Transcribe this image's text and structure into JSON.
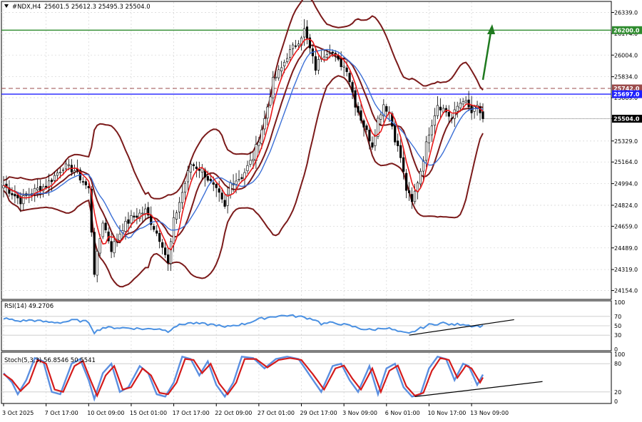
{
  "header": {
    "symbol": "#NDX,H4",
    "ohlc": "25601.5 25612.3 25495.3 25504.0"
  },
  "colors": {
    "candle": "#000000",
    "bollinger": "#7b1a1a",
    "ma_fast": "#e8191a",
    "ma_slow": "#3b6fd6",
    "rsi": "#4a90e2",
    "stoch_main": "#5b8fe0",
    "stoch_signal": "#d41b1b",
    "resistance": "#2e8b2e",
    "blue_level": "#1f1fff",
    "dashed_level": "#9b4b4b",
    "arrow": "#1f7a1f",
    "trendline": "#000000",
    "grid": "#d9d9d9",
    "price_tag_bg": "#000000"
  },
  "chart_data": [
    {
      "type": "candlestick",
      "panel": "price",
      "title": "#NDX,H4",
      "ylim": [
        24090,
        26420
      ],
      "y_ticks": [
        26339.0,
        26174.0,
        26004.0,
        25834.0,
        25669.0,
        25504.0,
        25329.0,
        25164.0,
        24994.0,
        24824.0,
        24659.0,
        24489.0,
        24319.0,
        24154.0
      ],
      "x_tick_labels": [
        "3 Oct 2025",
        "7 Oct 17:00",
        "10 Oct 09:00",
        "15 Oct 01:00",
        "17 Oct 17:00",
        "22 Oct 09:00",
        "27 Oct 01:00",
        "29 Oct 17:00",
        "3 Nov 09:00",
        "6 Nov 01:00",
        "10 Nov 17:00",
        "13 Nov 09:00"
      ],
      "x_tick_index": [
        0,
        15,
        30,
        45,
        60,
        75,
        90,
        105,
        120,
        135,
        150,
        165
      ],
      "last_price": 25504.0,
      "levels": [
        {
          "name": "resistance",
          "value": 26200.0,
          "label": "26200.0",
          "style": "solid"
        },
        {
          "name": "dashed",
          "value": 25742.0,
          "label": "25742.0",
          "style": "dashed"
        },
        {
          "name": "blue",
          "value": 25697.0,
          "label": "25697.0",
          "style": "solid"
        }
      ],
      "candles_close_keypoints": [
        [
          0,
          24980
        ],
        [
          6,
          24860
        ],
        [
          10,
          24930
        ],
        [
          15,
          24980
        ],
        [
          21,
          25130
        ],
        [
          25,
          25100
        ],
        [
          30,
          24950
        ],
        [
          32,
          24300
        ],
        [
          35,
          24700
        ],
        [
          38,
          24480
        ],
        [
          42,
          24650
        ],
        [
          45,
          24720
        ],
        [
          50,
          24780
        ],
        [
          56,
          24520
        ],
        [
          58,
          24360
        ],
        [
          60,
          24700
        ],
        [
          64,
          25000
        ],
        [
          66,
          25150
        ],
        [
          70,
          25100
        ],
        [
          76,
          24900
        ],
        [
          78,
          24800
        ],
        [
          80,
          25000
        ],
        [
          84,
          25050
        ],
        [
          88,
          25200
        ],
        [
          92,
          25500
        ],
        [
          95,
          25800
        ],
        [
          98,
          25900
        ],
        [
          100,
          26000
        ],
        [
          104,
          26120
        ],
        [
          106,
          26200
        ],
        [
          108,
          26050
        ],
        [
          110,
          25900
        ],
        [
          112,
          26000
        ],
        [
          115,
          26050
        ],
        [
          118,
          25950
        ],
        [
          121,
          25900
        ],
        [
          124,
          25620
        ],
        [
          127,
          25450
        ],
        [
          130,
          25300
        ],
        [
          132,
          25500
        ],
        [
          134,
          25620
        ],
        [
          136,
          25550
        ],
        [
          138,
          25350
        ],
        [
          140,
          25200
        ],
        [
          142,
          24950
        ],
        [
          144,
          24840
        ],
        [
          147,
          25100
        ],
        [
          150,
          25400
        ],
        [
          153,
          25620
        ],
        [
          156,
          25560
        ],
        [
          158,
          25500
        ],
        [
          160,
          25600
        ],
        [
          162,
          25660
        ],
        [
          165,
          25550
        ],
        [
          167,
          25600
        ],
        [
          169,
          25504
        ]
      ],
      "series": [
        {
          "name": "bollinger",
          "role": "bands"
        },
        {
          "name": "ma_fast",
          "role": "moving-average"
        },
        {
          "name": "ma_slow",
          "role": "moving-average"
        }
      ]
    },
    {
      "type": "line",
      "panel": "rsi",
      "title": "RSI(14) 49.2706",
      "ylim": [
        0,
        100
      ],
      "y_ticks": [
        100,
        70,
        50,
        30,
        0
      ],
      "series_keypoints": [
        [
          0,
          66
        ],
        [
          5,
          60
        ],
        [
          10,
          62
        ],
        [
          15,
          58
        ],
        [
          20,
          57
        ],
        [
          25,
          62
        ],
        [
          30,
          58
        ],
        [
          32,
          36
        ],
        [
          35,
          46
        ],
        [
          40,
          46
        ],
        [
          45,
          45
        ],
        [
          50,
          43
        ],
        [
          55,
          44
        ],
        [
          58,
          38
        ],
        [
          60,
          48
        ],
        [
          65,
          56
        ],
        [
          70,
          54
        ],
        [
          75,
          52
        ],
        [
          78,
          46
        ],
        [
          80,
          50
        ],
        [
          85,
          54
        ],
        [
          90,
          64
        ],
        [
          95,
          70
        ],
        [
          100,
          72
        ],
        [
          105,
          69
        ],
        [
          110,
          63
        ],
        [
          112,
          54
        ],
        [
          115,
          56
        ],
        [
          118,
          55
        ],
        [
          122,
          50
        ],
        [
          126,
          44
        ],
        [
          130,
          41
        ],
        [
          134,
          46
        ],
        [
          136,
          44
        ],
        [
          140,
          36
        ],
        [
          143,
          33
        ],
        [
          146,
          42
        ],
        [
          150,
          52
        ],
        [
          155,
          56
        ],
        [
          158,
          52
        ],
        [
          162,
          54
        ],
        [
          165,
          50
        ],
        [
          169,
          49.3
        ]
      ],
      "trendline": [
        [
          143,
          30
        ],
        [
          180,
          63
        ]
      ]
    },
    {
      "type": "line",
      "panel": "stochastic",
      "title": "Stoch(5,3,3) 56.8546 50.5541",
      "ylim": [
        0,
        100
      ],
      "y_ticks": [
        100,
        80,
        20,
        0
      ],
      "series": [
        {
          "name": "main",
          "values_keypoints": [
            [
              0,
              60
            ],
            [
              3,
              40
            ],
            [
              5,
              15
            ],
            [
              8,
              45
            ],
            [
              11,
              92
            ],
            [
              14,
              85
            ],
            [
              17,
              20
            ],
            [
              20,
              15
            ],
            [
              24,
              80
            ],
            [
              27,
              90
            ],
            [
              30,
              45
            ],
            [
              32,
              5
            ],
            [
              35,
              60
            ],
            [
              38,
              80
            ],
            [
              41,
              20
            ],
            [
              44,
              30
            ],
            [
              48,
              75
            ],
            [
              51,
              60
            ],
            [
              54,
              15
            ],
            [
              57,
              10
            ],
            [
              60,
              40
            ],
            [
              63,
              95
            ],
            [
              66,
              90
            ],
            [
              69,
              55
            ],
            [
              72,
              85
            ],
            [
              75,
              35
            ],
            [
              78,
              10
            ],
            [
              81,
              40
            ],
            [
              84,
              95
            ],
            [
              88,
              92
            ],
            [
              92,
              70
            ],
            [
              96,
              90
            ],
            [
              100,
              95
            ],
            [
              104,
              90
            ],
            [
              108,
              55
            ],
            [
              112,
              20
            ],
            [
              116,
              75
            ],
            [
              119,
              80
            ],
            [
              122,
              45
            ],
            [
              125,
              20
            ],
            [
              129,
              75
            ],
            [
              132,
              15
            ],
            [
              135,
              70
            ],
            [
              138,
              80
            ],
            [
              141,
              30
            ],
            [
              144,
              10
            ],
            [
              147,
              15
            ],
            [
              150,
              70
            ],
            [
              153,
              95
            ],
            [
              156,
              90
            ],
            [
              159,
              45
            ],
            [
              162,
              80
            ],
            [
              164,
              75
            ],
            [
              167,
              35
            ],
            [
              169,
              56.85
            ]
          ]
        },
        {
          "name": "signal",
          "values_keypoints": [
            [
              0,
              58
            ],
            [
              3,
              45
            ],
            [
              6,
              22
            ],
            [
              9,
              40
            ],
            [
              12,
              88
            ],
            [
              15,
              80
            ],
            [
              18,
              25
            ],
            [
              21,
              20
            ],
            [
              25,
              75
            ],
            [
              28,
              86
            ],
            [
              31,
              40
            ],
            [
              33,
              12
            ],
            [
              36,
              55
            ],
            [
              39,
              75
            ],
            [
              42,
              25
            ],
            [
              45,
              30
            ],
            [
              49,
              70
            ],
            [
              52,
              55
            ],
            [
              55,
              18
            ],
            [
              58,
              15
            ],
            [
              61,
              40
            ],
            [
              64,
              90
            ],
            [
              67,
              88
            ],
            [
              70,
              60
            ],
            [
              73,
              80
            ],
            [
              76,
              38
            ],
            [
              79,
              15
            ],
            [
              82,
              40
            ],
            [
              85,
              90
            ],
            [
              89,
              90
            ],
            [
              93,
              72
            ],
            [
              97,
              88
            ],
            [
              101,
              92
            ],
            [
              105,
              88
            ],
            [
              109,
              58
            ],
            [
              113,
              25
            ],
            [
              117,
              70
            ],
            [
              120,
              76
            ],
            [
              123,
              48
            ],
            [
              126,
              25
            ],
            [
              130,
              70
            ],
            [
              133,
              20
            ],
            [
              136,
              65
            ],
            [
              139,
              76
            ],
            [
              142,
              32
            ],
            [
              145,
              12
            ],
            [
              148,
              18
            ],
            [
              151,
              65
            ],
            [
              154,
              92
            ],
            [
              157,
              88
            ],
            [
              160,
              50
            ],
            [
              163,
              76
            ],
            [
              165,
              70
            ],
            [
              168,
              40
            ],
            [
              169,
              50.55
            ]
          ]
        }
      ],
      "trendline": [
        [
          145,
          10
        ],
        [
          190,
          42
        ]
      ]
    }
  ]
}
